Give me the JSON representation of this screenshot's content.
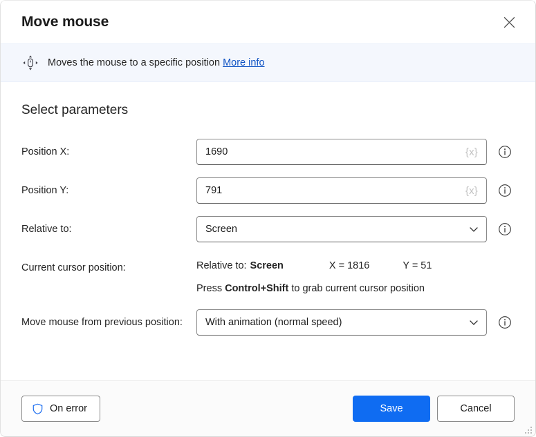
{
  "window": {
    "title": "Move mouse",
    "close_icon": "close-icon"
  },
  "banner": {
    "icon": "move-mouse-icon",
    "description": "Moves the mouse to a specific position",
    "link_label": "More info"
  },
  "main": {
    "section_title": "Select parameters",
    "fields": [
      {
        "label": "Position X:",
        "type": "textbox",
        "value": "1690",
        "variable_glyph": "{x}",
        "info_icon": "info-icon"
      },
      {
        "label": "Position Y:",
        "type": "textbox",
        "value": "791",
        "variable_glyph": "{x}",
        "info_icon": "info-icon"
      },
      {
        "label": "Relative to:",
        "type": "combobox",
        "value": "Screen",
        "chevron_icon": "chevron-down-icon",
        "info_icon": "info-icon"
      }
    ],
    "cursor_position": {
      "label": "Current cursor position:",
      "relative_to_label": "Relative to:",
      "relative_to_value": "Screen",
      "x_readout": "X = 1816",
      "y_readout": "Y = 51",
      "hint_prefix": "Press ",
      "hint_keys": "Control+Shift",
      "hint_suffix": " to grab current cursor position"
    },
    "animation_field": {
      "label": "Move mouse from previous position:",
      "type": "combobox",
      "value": "With animation (normal speed)",
      "chevron_icon": "chevron-down-icon",
      "info_icon": "info-icon"
    }
  },
  "footer": {
    "on_error_label": "On error",
    "on_error_icon": "shield-icon",
    "save_label": "Save",
    "cancel_label": "Cancel",
    "resize_grip": "resize-grip-icon"
  },
  "colors": {
    "accent": "#0f6cf2",
    "link": "#1154c4",
    "banner_bg": "#f4f7fd",
    "shield": "#1a6cf0"
  }
}
